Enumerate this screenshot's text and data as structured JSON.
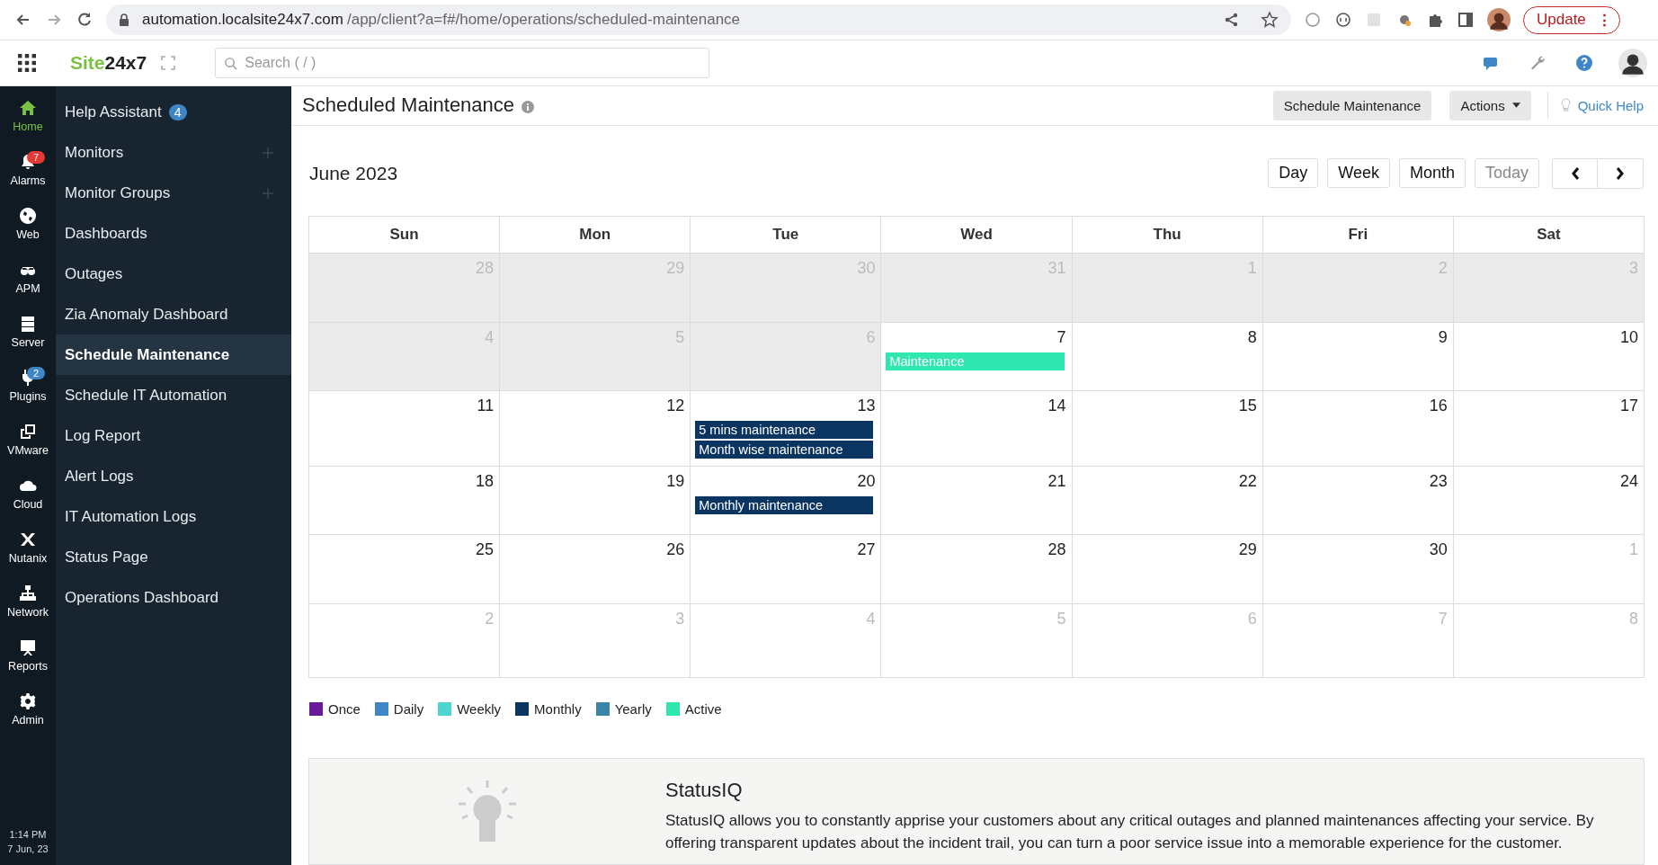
{
  "browser": {
    "url_host": "automation.localsite24x7.com",
    "url_path": "/app/client?a=f#/home/operations/scheduled-maintenance",
    "update_label": "Update",
    "menu_glyph": "⋮"
  },
  "header": {
    "logo_a": "Site",
    "logo_b": "24x7",
    "search_placeholder": "Search ( / )"
  },
  "rail": [
    {
      "label": "Home",
      "selected": true
    },
    {
      "label": "Alarms",
      "selected": false,
      "badge": "7",
      "color": "#e53935"
    },
    {
      "label": "Web",
      "selected": false
    },
    {
      "label": "APM",
      "selected": false
    },
    {
      "label": "Server",
      "selected": false
    },
    {
      "label": "Plugins",
      "selected": false,
      "badge": "2",
      "color": "#3f86c6"
    },
    {
      "label": "VMware",
      "selected": false
    },
    {
      "label": "Cloud",
      "selected": false
    },
    {
      "label": "Nutanix",
      "selected": false
    },
    {
      "label": "Network",
      "selected": false
    },
    {
      "label": "Reports",
      "selected": false
    },
    {
      "label": "Admin",
      "selected": false
    }
  ],
  "clock": {
    "time": "1:14 PM",
    "date": "7 Jun, 23"
  },
  "sidebar": {
    "items": [
      {
        "label": "Help Assistant",
        "badge": "4",
        "add": false,
        "selected": false
      },
      {
        "label": "Monitors",
        "add": true,
        "selected": false
      },
      {
        "label": "Monitor Groups",
        "add": true,
        "selected": false
      },
      {
        "label": "Dashboards",
        "add": false,
        "selected": false
      },
      {
        "label": "Outages",
        "add": false,
        "selected": false
      },
      {
        "label": "Zia Anomaly Dashboard",
        "add": false,
        "selected": false
      },
      {
        "label": "Schedule Maintenance",
        "add": false,
        "selected": true
      },
      {
        "label": "Schedule IT Automation",
        "add": false,
        "selected": false
      },
      {
        "label": "Log Report",
        "add": false,
        "selected": false
      },
      {
        "label": "Alert Logs",
        "add": false,
        "selected": false
      },
      {
        "label": "IT Automation Logs",
        "add": false,
        "selected": false
      },
      {
        "label": "Status Page",
        "add": false,
        "selected": false
      },
      {
        "label": "Operations Dashboard",
        "add": false,
        "selected": false
      }
    ]
  },
  "page": {
    "title": "Scheduled Maintenance",
    "buttons": [
      "Schedule Maintenance",
      "Actions"
    ],
    "quick_help": "Quick Help"
  },
  "calendar": {
    "month": "June 2023",
    "views": [
      {
        "label": "Day",
        "disabled": false
      },
      {
        "label": "Week",
        "disabled": false
      },
      {
        "label": "Month",
        "disabled": false
      },
      {
        "label": "Today",
        "disabled": true
      }
    ],
    "weekdays": [
      "Sun",
      "Mon",
      "Tue",
      "Wed",
      "Thu",
      "Fri",
      "Sat"
    ],
    "weeks": [
      [
        {
          "day": "28",
          "muted": true,
          "past": true
        },
        {
          "day": "29",
          "muted": true,
          "past": true
        },
        {
          "day": "30",
          "muted": true,
          "past": true
        },
        {
          "day": "31",
          "muted": true,
          "past": true
        },
        {
          "day": "1",
          "muted": true,
          "past": true
        },
        {
          "day": "2",
          "muted": true,
          "past": true
        },
        {
          "day": "3",
          "muted": true,
          "past": true
        }
      ],
      [
        {
          "day": "4",
          "muted": true,
          "past": true
        },
        {
          "day": "5",
          "muted": true,
          "past": true
        },
        {
          "day": "6",
          "muted": true,
          "past": true
        },
        {
          "day": "7",
          "muted": false,
          "past": false,
          "events": [
            {
              "label": "Maintenance",
              "color": "#2ee8b0"
            }
          ]
        },
        {
          "day": "8",
          "muted": false,
          "past": false
        },
        {
          "day": "9",
          "muted": false,
          "past": false
        },
        {
          "day": "10",
          "muted": false,
          "past": false
        }
      ],
      [
        {
          "day": "11",
          "muted": false,
          "past": false
        },
        {
          "day": "12",
          "muted": false,
          "past": false
        },
        {
          "day": "13",
          "muted": false,
          "past": false,
          "events": [
            {
              "label": "5 mins maintenance",
              "color": "#0b3561"
            },
            {
              "label": "Month wise maintenance",
              "color": "#0b3561"
            }
          ]
        },
        {
          "day": "14",
          "muted": false,
          "past": false
        },
        {
          "day": "15",
          "muted": false,
          "past": false
        },
        {
          "day": "16",
          "muted": false,
          "past": false
        },
        {
          "day": "17",
          "muted": false,
          "past": false
        }
      ],
      [
        {
          "day": "18",
          "muted": false,
          "past": false
        },
        {
          "day": "19",
          "muted": false,
          "past": false
        },
        {
          "day": "20",
          "muted": false,
          "past": false,
          "events": [
            {
              "label": "Monthly maintenance",
              "color": "#0b3561"
            }
          ]
        },
        {
          "day": "21",
          "muted": false,
          "past": false
        },
        {
          "day": "22",
          "muted": false,
          "past": false
        },
        {
          "day": "23",
          "muted": false,
          "past": false
        },
        {
          "day": "24",
          "muted": false,
          "past": false
        }
      ],
      [
        {
          "day": "25",
          "muted": false,
          "past": false
        },
        {
          "day": "26",
          "muted": false,
          "past": false
        },
        {
          "day": "27",
          "muted": false,
          "past": false
        },
        {
          "day": "28",
          "muted": false,
          "past": false
        },
        {
          "day": "29",
          "muted": false,
          "past": false
        },
        {
          "day": "30",
          "muted": false,
          "past": false
        },
        {
          "day": "1",
          "muted": true,
          "past": false
        }
      ],
      [
        {
          "day": "2",
          "muted": true,
          "past": false
        },
        {
          "day": "3",
          "muted": true,
          "past": false
        },
        {
          "day": "4",
          "muted": true,
          "past": false
        },
        {
          "day": "5",
          "muted": true,
          "past": false
        },
        {
          "day": "6",
          "muted": true,
          "past": false
        },
        {
          "day": "7",
          "muted": true,
          "past": false
        },
        {
          "day": "8",
          "muted": true,
          "past": false
        }
      ]
    ]
  },
  "legend": [
    {
      "label": "Once",
      "color": "#6a1b9a"
    },
    {
      "label": "Daily",
      "color": "#3f86c6"
    },
    {
      "label": "Weekly",
      "color": "#4dd6d0"
    },
    {
      "label": "Monthly",
      "color": "#0b3561"
    },
    {
      "label": "Yearly",
      "color": "#3a84a8"
    },
    {
      "label": "Active",
      "color": "#2ee8b0"
    }
  ],
  "statusiq": {
    "title": "StatusIQ",
    "text": "StatusIQ allows you to constantly apprise your customers about any critical outages and planned maintenances affecting your service. By offering transparent updates about the incident trail, you can turn a poor service issue into a memorable experience for the customer."
  }
}
